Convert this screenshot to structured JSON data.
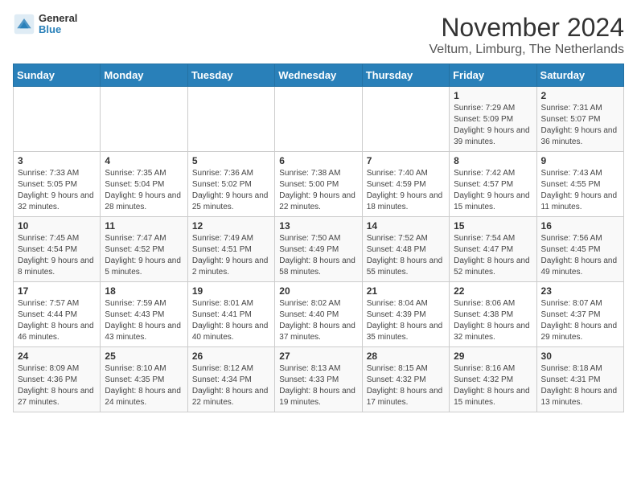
{
  "logo": {
    "line1": "General",
    "line2": "Blue"
  },
  "title": "November 2024",
  "subtitle": "Veltum, Limburg, The Netherlands",
  "weekdays": [
    "Sunday",
    "Monday",
    "Tuesday",
    "Wednesday",
    "Thursday",
    "Friday",
    "Saturday"
  ],
  "weeks": [
    [
      {
        "day": "",
        "info": ""
      },
      {
        "day": "",
        "info": ""
      },
      {
        "day": "",
        "info": ""
      },
      {
        "day": "",
        "info": ""
      },
      {
        "day": "",
        "info": ""
      },
      {
        "day": "1",
        "info": "Sunrise: 7:29 AM\nSunset: 5:09 PM\nDaylight: 9 hours\nand 39 minutes."
      },
      {
        "day": "2",
        "info": "Sunrise: 7:31 AM\nSunset: 5:07 PM\nDaylight: 9 hours\nand 36 minutes."
      }
    ],
    [
      {
        "day": "3",
        "info": "Sunrise: 7:33 AM\nSunset: 5:05 PM\nDaylight: 9 hours\nand 32 minutes."
      },
      {
        "day": "4",
        "info": "Sunrise: 7:35 AM\nSunset: 5:04 PM\nDaylight: 9 hours\nand 28 minutes."
      },
      {
        "day": "5",
        "info": "Sunrise: 7:36 AM\nSunset: 5:02 PM\nDaylight: 9 hours\nand 25 minutes."
      },
      {
        "day": "6",
        "info": "Sunrise: 7:38 AM\nSunset: 5:00 PM\nDaylight: 9 hours\nand 22 minutes."
      },
      {
        "day": "7",
        "info": "Sunrise: 7:40 AM\nSunset: 4:59 PM\nDaylight: 9 hours\nand 18 minutes."
      },
      {
        "day": "8",
        "info": "Sunrise: 7:42 AM\nSunset: 4:57 PM\nDaylight: 9 hours\nand 15 minutes."
      },
      {
        "day": "9",
        "info": "Sunrise: 7:43 AM\nSunset: 4:55 PM\nDaylight: 9 hours\nand 11 minutes."
      }
    ],
    [
      {
        "day": "10",
        "info": "Sunrise: 7:45 AM\nSunset: 4:54 PM\nDaylight: 9 hours\nand 8 minutes."
      },
      {
        "day": "11",
        "info": "Sunrise: 7:47 AM\nSunset: 4:52 PM\nDaylight: 9 hours\nand 5 minutes."
      },
      {
        "day": "12",
        "info": "Sunrise: 7:49 AM\nSunset: 4:51 PM\nDaylight: 9 hours\nand 2 minutes."
      },
      {
        "day": "13",
        "info": "Sunrise: 7:50 AM\nSunset: 4:49 PM\nDaylight: 8 hours\nand 58 minutes."
      },
      {
        "day": "14",
        "info": "Sunrise: 7:52 AM\nSunset: 4:48 PM\nDaylight: 8 hours\nand 55 minutes."
      },
      {
        "day": "15",
        "info": "Sunrise: 7:54 AM\nSunset: 4:47 PM\nDaylight: 8 hours\nand 52 minutes."
      },
      {
        "day": "16",
        "info": "Sunrise: 7:56 AM\nSunset: 4:45 PM\nDaylight: 8 hours\nand 49 minutes."
      }
    ],
    [
      {
        "day": "17",
        "info": "Sunrise: 7:57 AM\nSunset: 4:44 PM\nDaylight: 8 hours\nand 46 minutes."
      },
      {
        "day": "18",
        "info": "Sunrise: 7:59 AM\nSunset: 4:43 PM\nDaylight: 8 hours\nand 43 minutes."
      },
      {
        "day": "19",
        "info": "Sunrise: 8:01 AM\nSunset: 4:41 PM\nDaylight: 8 hours\nand 40 minutes."
      },
      {
        "day": "20",
        "info": "Sunrise: 8:02 AM\nSunset: 4:40 PM\nDaylight: 8 hours\nand 37 minutes."
      },
      {
        "day": "21",
        "info": "Sunrise: 8:04 AM\nSunset: 4:39 PM\nDaylight: 8 hours\nand 35 minutes."
      },
      {
        "day": "22",
        "info": "Sunrise: 8:06 AM\nSunset: 4:38 PM\nDaylight: 8 hours\nand 32 minutes."
      },
      {
        "day": "23",
        "info": "Sunrise: 8:07 AM\nSunset: 4:37 PM\nDaylight: 8 hours\nand 29 minutes."
      }
    ],
    [
      {
        "day": "24",
        "info": "Sunrise: 8:09 AM\nSunset: 4:36 PM\nDaylight: 8 hours\nand 27 minutes."
      },
      {
        "day": "25",
        "info": "Sunrise: 8:10 AM\nSunset: 4:35 PM\nDaylight: 8 hours\nand 24 minutes."
      },
      {
        "day": "26",
        "info": "Sunrise: 8:12 AM\nSunset: 4:34 PM\nDaylight: 8 hours\nand 22 minutes."
      },
      {
        "day": "27",
        "info": "Sunrise: 8:13 AM\nSunset: 4:33 PM\nDaylight: 8 hours\nand 19 minutes."
      },
      {
        "day": "28",
        "info": "Sunrise: 8:15 AM\nSunset: 4:32 PM\nDaylight: 8 hours\nand 17 minutes."
      },
      {
        "day": "29",
        "info": "Sunrise: 8:16 AM\nSunset: 4:32 PM\nDaylight: 8 hours\nand 15 minutes."
      },
      {
        "day": "30",
        "info": "Sunrise: 8:18 AM\nSunset: 4:31 PM\nDaylight: 8 hours\nand 13 minutes."
      }
    ]
  ]
}
